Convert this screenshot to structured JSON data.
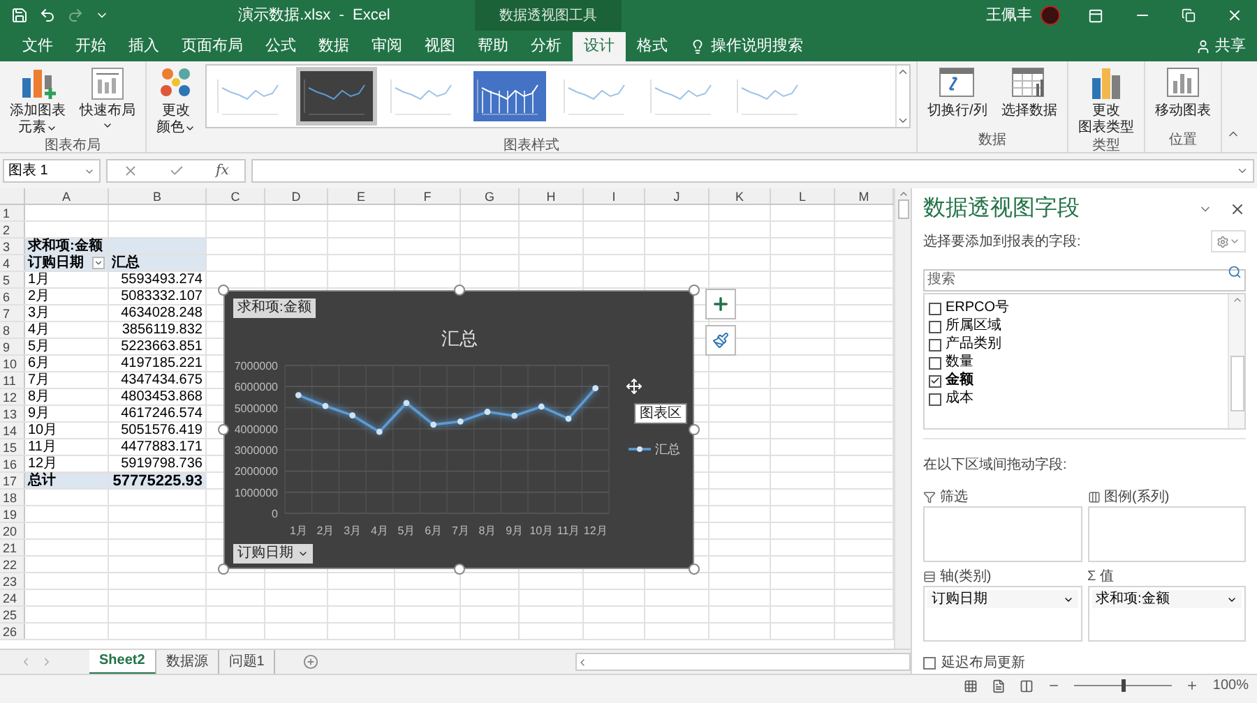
{
  "title_bar": {
    "title": "演示数据.xlsx  -  Excel",
    "context_title": "数据透视图工具",
    "user": "王佩丰"
  },
  "tabs": [
    {
      "label": "文件",
      "selected": false
    },
    {
      "label": "开始",
      "selected": false
    },
    {
      "label": "插入",
      "selected": false
    },
    {
      "label": "页面布局",
      "selected": false
    },
    {
      "label": "公式",
      "selected": false
    },
    {
      "label": "数据",
      "selected": false
    },
    {
      "label": "审阅",
      "selected": false
    },
    {
      "label": "视图",
      "selected": false
    },
    {
      "label": "帮助",
      "selected": false
    },
    {
      "label": "分析",
      "selected": false
    },
    {
      "label": "设计",
      "selected": true
    },
    {
      "label": "格式",
      "selected": false
    }
  ],
  "tell_me": "操作说明搜索",
  "share": "共享",
  "ribbon": {
    "groups": [
      {
        "label": "图表布局",
        "items": [
          {
            "kind": "button",
            "lines": [
              "添加图表",
              "元素"
            ],
            "dropdown": true
          },
          {
            "kind": "button",
            "lines": [
              "快速布局"
            ],
            "dropdown": true
          }
        ]
      },
      {
        "label": "图表样式",
        "items": [
          {
            "kind": "button",
            "lines": [
              "更改",
              "颜色"
            ],
            "dropdown": true
          },
          {
            "kind": "gallery",
            "styles": [
              {
                "kind": "light",
                "selected": false
              },
              {
                "kind": "dark",
                "selected": true
              },
              {
                "kind": "light",
                "selected": false
              },
              {
                "kind": "blue",
                "selected": false
              },
              {
                "kind": "light",
                "selected": false
              },
              {
                "kind": "light",
                "selected": false
              },
              {
                "kind": "light",
                "selected": false
              }
            ]
          }
        ]
      },
      {
        "label": "数据",
        "items": [
          {
            "kind": "button",
            "lines": [
              "切换行/列"
            ],
            "dropdown": false
          },
          {
            "kind": "button",
            "lines": [
              "选择数据"
            ],
            "dropdown": false
          }
        ]
      },
      {
        "label": "类型",
        "items": [
          {
            "kind": "button",
            "lines": [
              "更改",
              "图表类型"
            ],
            "dropdown": false
          }
        ]
      },
      {
        "label": "位置",
        "items": [
          {
            "kind": "button",
            "lines": [
              "移动图表"
            ],
            "dropdown": false
          }
        ]
      }
    ]
  },
  "formula_bar": {
    "name_box": "图表 1",
    "function_label": "fx"
  },
  "sheet": {
    "columns": [
      "A",
      "B",
      "C",
      "D",
      "E",
      "F",
      "G",
      "H",
      "I",
      "J",
      "K",
      "L",
      "M"
    ],
    "rows": [
      {
        "number": "1"
      },
      {
        "number": "2"
      },
      {
        "number": "3",
        "kind": "pivot_header",
        "a": "求和项:金额"
      },
      {
        "number": "4",
        "kind": "pivot_header",
        "a": "订购日期",
        "b": "汇总",
        "filter": true
      },
      {
        "number": "5",
        "kind": "item",
        "a": "1月",
        "b": "5593493.274"
      },
      {
        "number": "6",
        "kind": "item",
        "a": "2月",
        "b": "5083332.107"
      },
      {
        "number": "7",
        "kind": "item",
        "a": "3月",
        "b": "4634028.248"
      },
      {
        "number": "8",
        "kind": "item",
        "a": "4月",
        "b": "3856119.832"
      },
      {
        "number": "9",
        "kind": "item",
        "a": "5月",
        "b": "5223663.851"
      },
      {
        "number": "10",
        "kind": "item",
        "a": "6月",
        "b": "4197185.221"
      },
      {
        "number": "11",
        "kind": "item",
        "a": "7月",
        "b": "4347434.675"
      },
      {
        "number": "12",
        "kind": "item",
        "a": "8月",
        "b": "4803453.868"
      },
      {
        "number": "13",
        "kind": "item",
        "a": "9月",
        "b": "4617246.574"
      },
      {
        "number": "14",
        "kind": "item",
        "a": "10月",
        "b": "5051576.419"
      },
      {
        "number": "15",
        "kind": "item",
        "a": "11月",
        "b": "4477883.171"
      },
      {
        "number": "16",
        "kind": "item",
        "a": "12月",
        "b": "5919798.736"
      },
      {
        "number": "17",
        "kind": "total",
        "a": "总计",
        "b": "57775225.93"
      },
      {
        "number": "18"
      },
      {
        "number": "19"
      },
      {
        "number": "20"
      },
      {
        "number": "21"
      },
      {
        "number": "22"
      },
      {
        "number": "23"
      },
      {
        "number": "24"
      },
      {
        "number": "25"
      },
      {
        "number": "26"
      }
    ]
  },
  "chart": {
    "value_field": "求和项:金额",
    "axis_field": "订购日期",
    "tooltip": "图表区",
    "chart_data": {
      "type": "line",
      "title": "汇总",
      "categories": [
        "1月",
        "2月",
        "3月",
        "4月",
        "5月",
        "6月",
        "7月",
        "8月",
        "9月",
        "10月",
        "11月",
        "12月"
      ],
      "series": [
        {
          "name": "汇总",
          "color": "#5b9bd5",
          "values": [
            5593493.274,
            5083332.107,
            4634028.248,
            3856119.832,
            5223663.851,
            4197185.221,
            4347434.675,
            4803453.868,
            4617246.574,
            5051576.419,
            4477883.171,
            5919798.736
          ]
        }
      ],
      "grid": true,
      "marker": true,
      "ylim": [
        0,
        7000000
      ],
      "yticks": [
        0,
        1000000,
        2000000,
        3000000,
        4000000,
        5000000,
        6000000,
        7000000
      ]
    }
  },
  "sheet_tabs": [
    {
      "label": "Sheet2",
      "selected": true
    },
    {
      "label": "数据源",
      "selected": false
    },
    {
      "label": "问题1",
      "selected": false
    }
  ],
  "field_pane": {
    "title": "数据透视图字段",
    "subtitle": "选择要添加到报表的字段:",
    "search_placeholder": "搜索",
    "fields": [
      {
        "label": "ERPCO号",
        "checked": false
      },
      {
        "label": "所属区域",
        "checked": false
      },
      {
        "label": "产品类别",
        "checked": false
      },
      {
        "label": "数量",
        "checked": false
      },
      {
        "label": "金额",
        "checked": true
      },
      {
        "label": "成本",
        "checked": false
      }
    ],
    "drag_hint": "在以下区域间拖动字段:",
    "areas": [
      {
        "kind": "filter",
        "label": "筛选"
      },
      {
        "kind": "legend",
        "label": "图例(系列)"
      },
      {
        "kind": "axis",
        "label": "轴(类别)",
        "items": [
          "订购日期"
        ]
      },
      {
        "kind": "values",
        "symbol": "Σ",
        "label": "值",
        "items": [
          "求和项:金额"
        ]
      }
    ],
    "defer_update": {
      "label": "延迟布局更新",
      "checked": false
    }
  },
  "status_bar": {
    "zoom": "100%",
    "zoom_slider": {
      "level": 0.5
    }
  }
}
